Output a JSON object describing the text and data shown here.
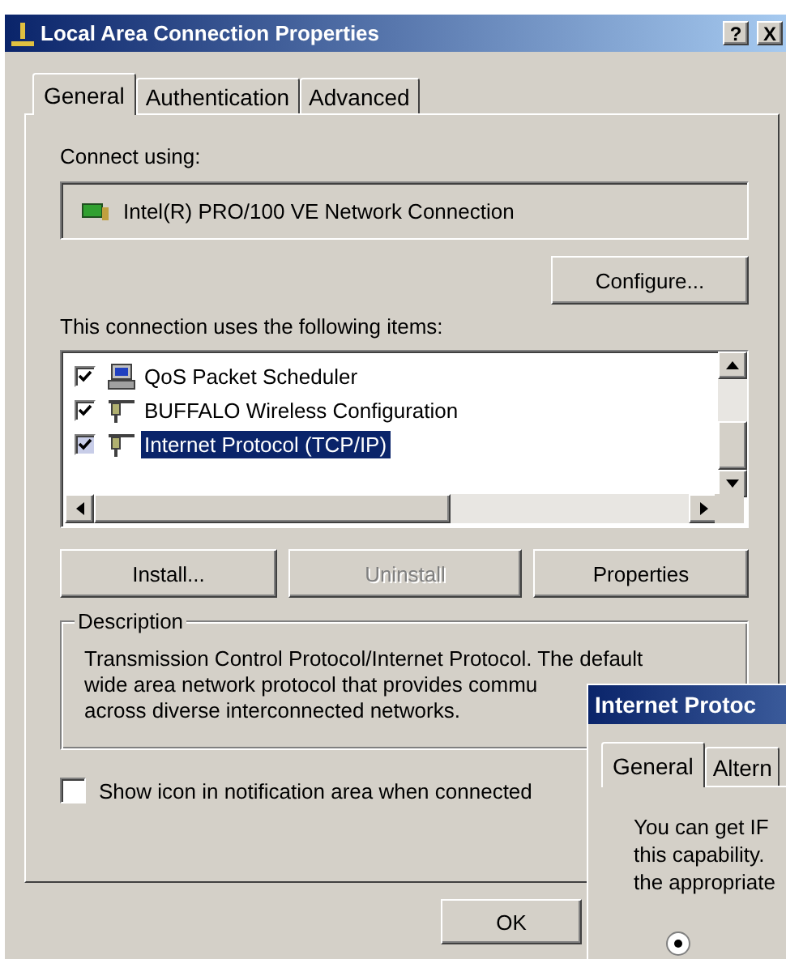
{
  "window": {
    "title": "Local Area Connection Properties",
    "help_button": "?",
    "close_button": "X"
  },
  "tabs": [
    {
      "label": "General",
      "selected": true
    },
    {
      "label": "Authentication",
      "selected": false
    },
    {
      "label": "Advanced",
      "selected": false
    }
  ],
  "connect_using": {
    "label": "Connect using:",
    "adapter": "Intel(R) PRO/100 VE Network Connection"
  },
  "configure_button": "Configure...",
  "items_label": "This connection uses the following items:",
  "items": [
    {
      "label": "QoS Packet Scheduler",
      "checked": true,
      "selected": false,
      "kind": "scheduler"
    },
    {
      "label": "BUFFALO Wireless Configuration",
      "checked": true,
      "selected": false,
      "kind": "protocol"
    },
    {
      "label": "Internet Protocol (TCP/IP)",
      "checked": true,
      "selected": true,
      "kind": "protocol"
    }
  ],
  "buttons": [
    {
      "label": "Install...",
      "disabled": false
    },
    {
      "label": "Uninstall",
      "disabled": true
    },
    {
      "label": "Properties",
      "disabled": false
    }
  ],
  "description": {
    "title": "Description",
    "lines": [
      "Transmission Control Protocol/Internet Protocol. The default",
      "wide area network protocol that provides commu",
      "across diverse interconnected networks."
    ]
  },
  "notify_checkbox": {
    "label": "Show icon in notification area when connected",
    "checked": false
  },
  "footer_buttons": [
    "OK"
  ],
  "ip_dialog": {
    "title": "Internet Protoc",
    "tabs": [
      {
        "label": "General",
        "selected": true
      },
      {
        "label": "Altern",
        "selected": false
      }
    ],
    "intro_lines": [
      "You can get IF",
      "this capability.",
      "the appropriate"
    ],
    "radio": {
      "selected": true
    }
  }
}
